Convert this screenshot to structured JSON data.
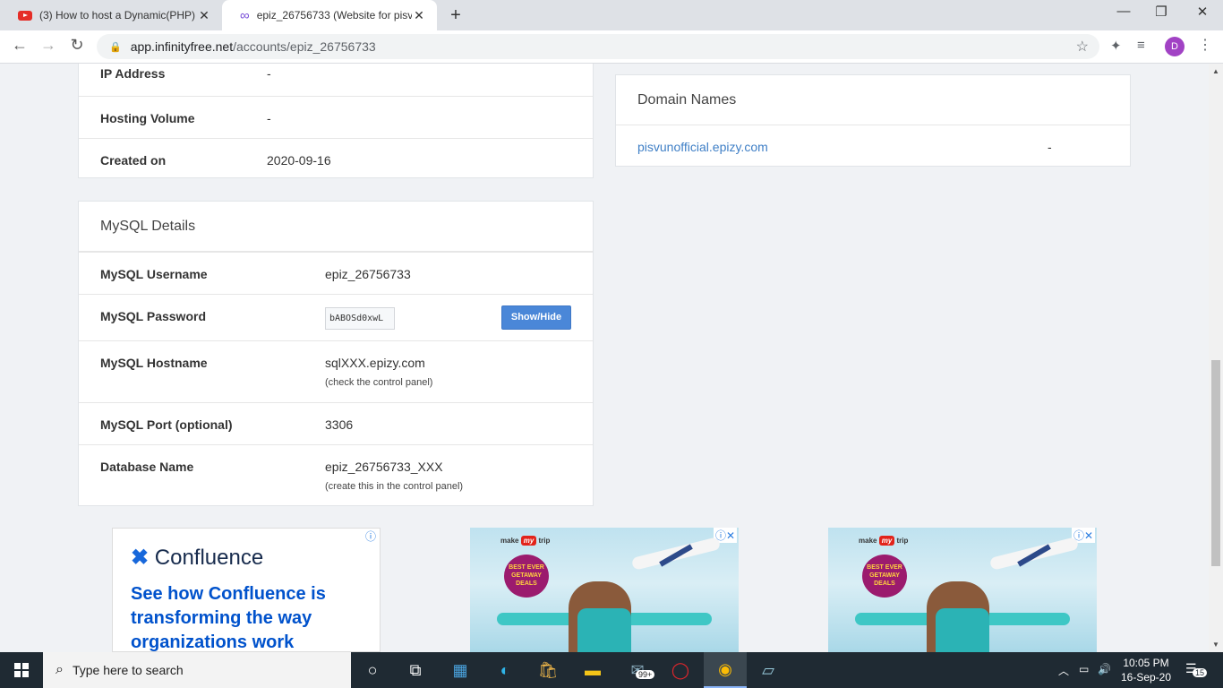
{
  "browser": {
    "tabs": [
      {
        "title": "(3) How to host a Dynamic(PHP)",
        "icon": "youtube-icon"
      },
      {
        "title": "epiz_26756733 (Website for pisvu",
        "icon": "infinityfree-icon"
      }
    ],
    "new_tab": "+",
    "window_controls": {
      "minimize": "—",
      "restore": "❐",
      "close": "✕"
    },
    "url_host": "app.infinityfree.net",
    "url_path": "/accounts/epiz_26756733",
    "profile_initial": "D"
  },
  "account_card": {
    "rows": [
      {
        "label": "IP Address",
        "value": "-"
      },
      {
        "label": "Hosting Volume",
        "value": "-"
      },
      {
        "label": "Created on",
        "value": "2020-09-16"
      }
    ]
  },
  "domain_card": {
    "title": "Domain Names",
    "domains": [
      {
        "name": "pisvunofficial.epizy.com",
        "status": "-"
      }
    ]
  },
  "mysql_card": {
    "title": "MySQL Details",
    "username_label": "MySQL Username",
    "username": "epiz_26756733",
    "password_label": "MySQL Password",
    "password": "bABOSd0xwL",
    "show_hide_label": "Show/Hide",
    "hostname_label": "MySQL Hostname",
    "hostname": "sqlXXX.epizy.com",
    "hostname_note": "(check the control panel)",
    "port_label": "MySQL Port (optional)",
    "port": "3306",
    "dbname_label": "Database Name",
    "dbname": "epiz_26756733_XXX",
    "dbname_note": "(create this in the control panel)"
  },
  "ads": {
    "confluence_brand": "Confluence",
    "confluence_text": "See how Confluence is transforming the way organizations work",
    "mmt_brand_pre": "make",
    "mmt_brand_my": "my",
    "mmt_brand_post": "trip",
    "mmt_badge": "BEST EVER GETAWAY DEALS"
  },
  "taskbar": {
    "search_placeholder": "Type here to search",
    "mail_badge": "99+",
    "time": "10:05 PM",
    "date": "16-Sep-20",
    "notifications": "15"
  },
  "colors": {
    "link": "#3f7fc6",
    "button": "#4a87d8",
    "taskbar": "#1f2a33"
  }
}
